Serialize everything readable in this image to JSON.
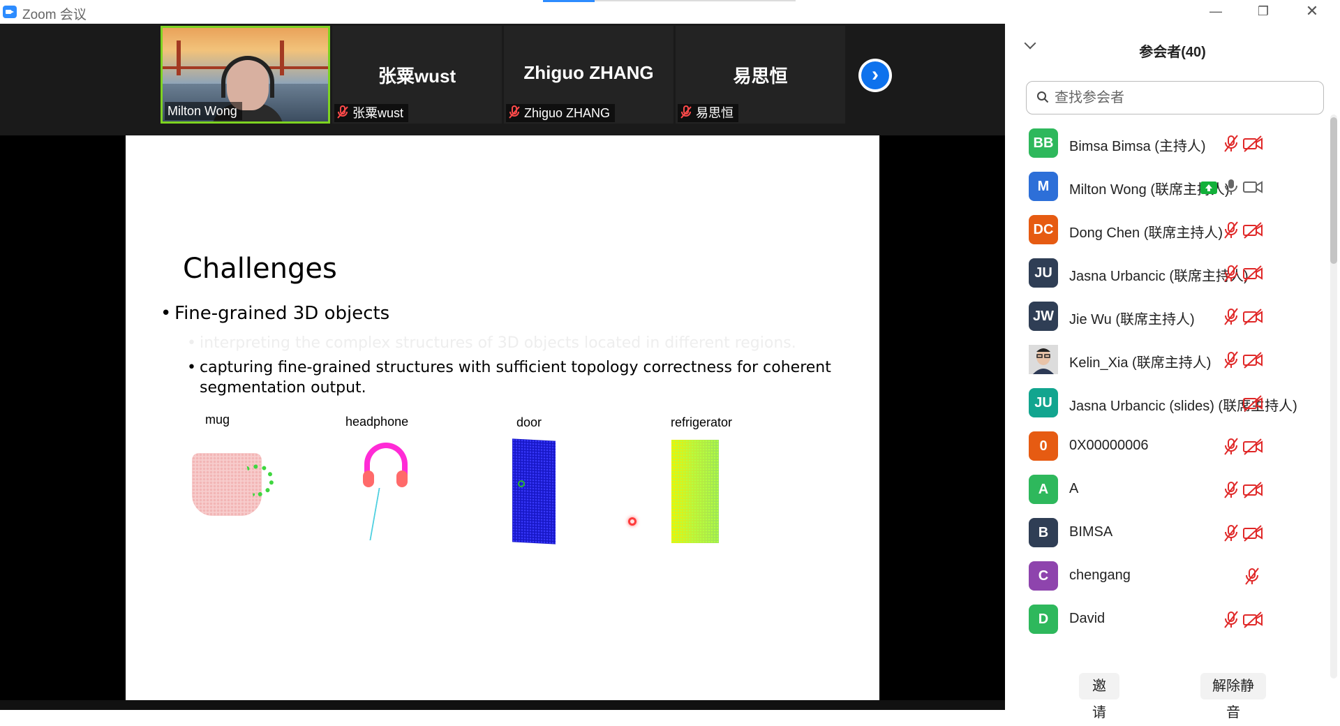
{
  "window": {
    "title": "Zoom 会议"
  },
  "video_strip": {
    "tiles": [
      {
        "label": "Milton Wong",
        "big_name": ""
      },
      {
        "label": "张粟wust",
        "big_name": "张粟wust"
      },
      {
        "label": "Zhiguo ZHANG",
        "big_name": "Zhiguo ZHANG"
      },
      {
        "label": "易思恒",
        "big_name": "易思恒"
      }
    ],
    "next_icon": "chevron-right-icon"
  },
  "slide": {
    "title": "Challenges",
    "bullets": [
      "Fine-grained 3D objects",
      "interpreting the complex structures of 3D objects located in different regions.",
      "capturing fine-grained structures with sufficient topology correctness for coherent segmentation output."
    ],
    "bullet_char": "•",
    "objects": [
      "mug",
      "headphone",
      "door",
      "refrigerator"
    ]
  },
  "participants": {
    "title": "参会者(40)",
    "search_placeholder": "查找参会者",
    "list": [
      {
        "initials": "BB",
        "color": "#2eb85c",
        "name": "Bimsa Bimsa (主持人)",
        "mic": "muted",
        "cam": "off"
      },
      {
        "initials": "M",
        "color": "#2d6fd8",
        "name": "Milton Wong (联席主持人)",
        "mic": "on",
        "cam": "on",
        "sharing": true
      },
      {
        "initials": "DC",
        "color": "#e65b12",
        "name": "Dong Chen (联席主持人)",
        "mic": "muted",
        "cam": "off"
      },
      {
        "initials": "JU",
        "color": "#2f3e55",
        "name": "Jasna Urbancic (联席主持人)",
        "mic": "muted",
        "cam": "off"
      },
      {
        "initials": "JW",
        "color": "#2f3e55",
        "name": "Jie Wu (联席主持人)",
        "mic": "muted",
        "cam": "off"
      },
      {
        "initials": "",
        "color": "#c9c9c9",
        "name": "Kelin_Xia (联席主持人)",
        "mic": "muted",
        "cam": "off",
        "photo": true
      },
      {
        "initials": "JU",
        "color": "#12a58f",
        "name": "Jasna Urbancic (slides) (联席主持人)",
        "mic": "none",
        "cam": "off"
      },
      {
        "initials": "0",
        "color": "#e65b12",
        "name": "0X00000006",
        "mic": "muted",
        "cam": "off"
      },
      {
        "initials": "A",
        "color": "#2eb85c",
        "name": "A",
        "mic": "muted",
        "cam": "off"
      },
      {
        "initials": "B",
        "color": "#2f3e55",
        "name": "BIMSA",
        "mic": "muted",
        "cam": "off"
      },
      {
        "initials": "C",
        "color": "#8e44ad",
        "name": "chengang",
        "mic": "none",
        "cam": "muted-only"
      },
      {
        "initials": "D",
        "color": "#2eb85c",
        "name": "David",
        "mic": "muted",
        "cam": "off"
      }
    ],
    "invite_label": "邀请",
    "unmute_all_label": "解除静音",
    "muted_color": "#e02828"
  }
}
